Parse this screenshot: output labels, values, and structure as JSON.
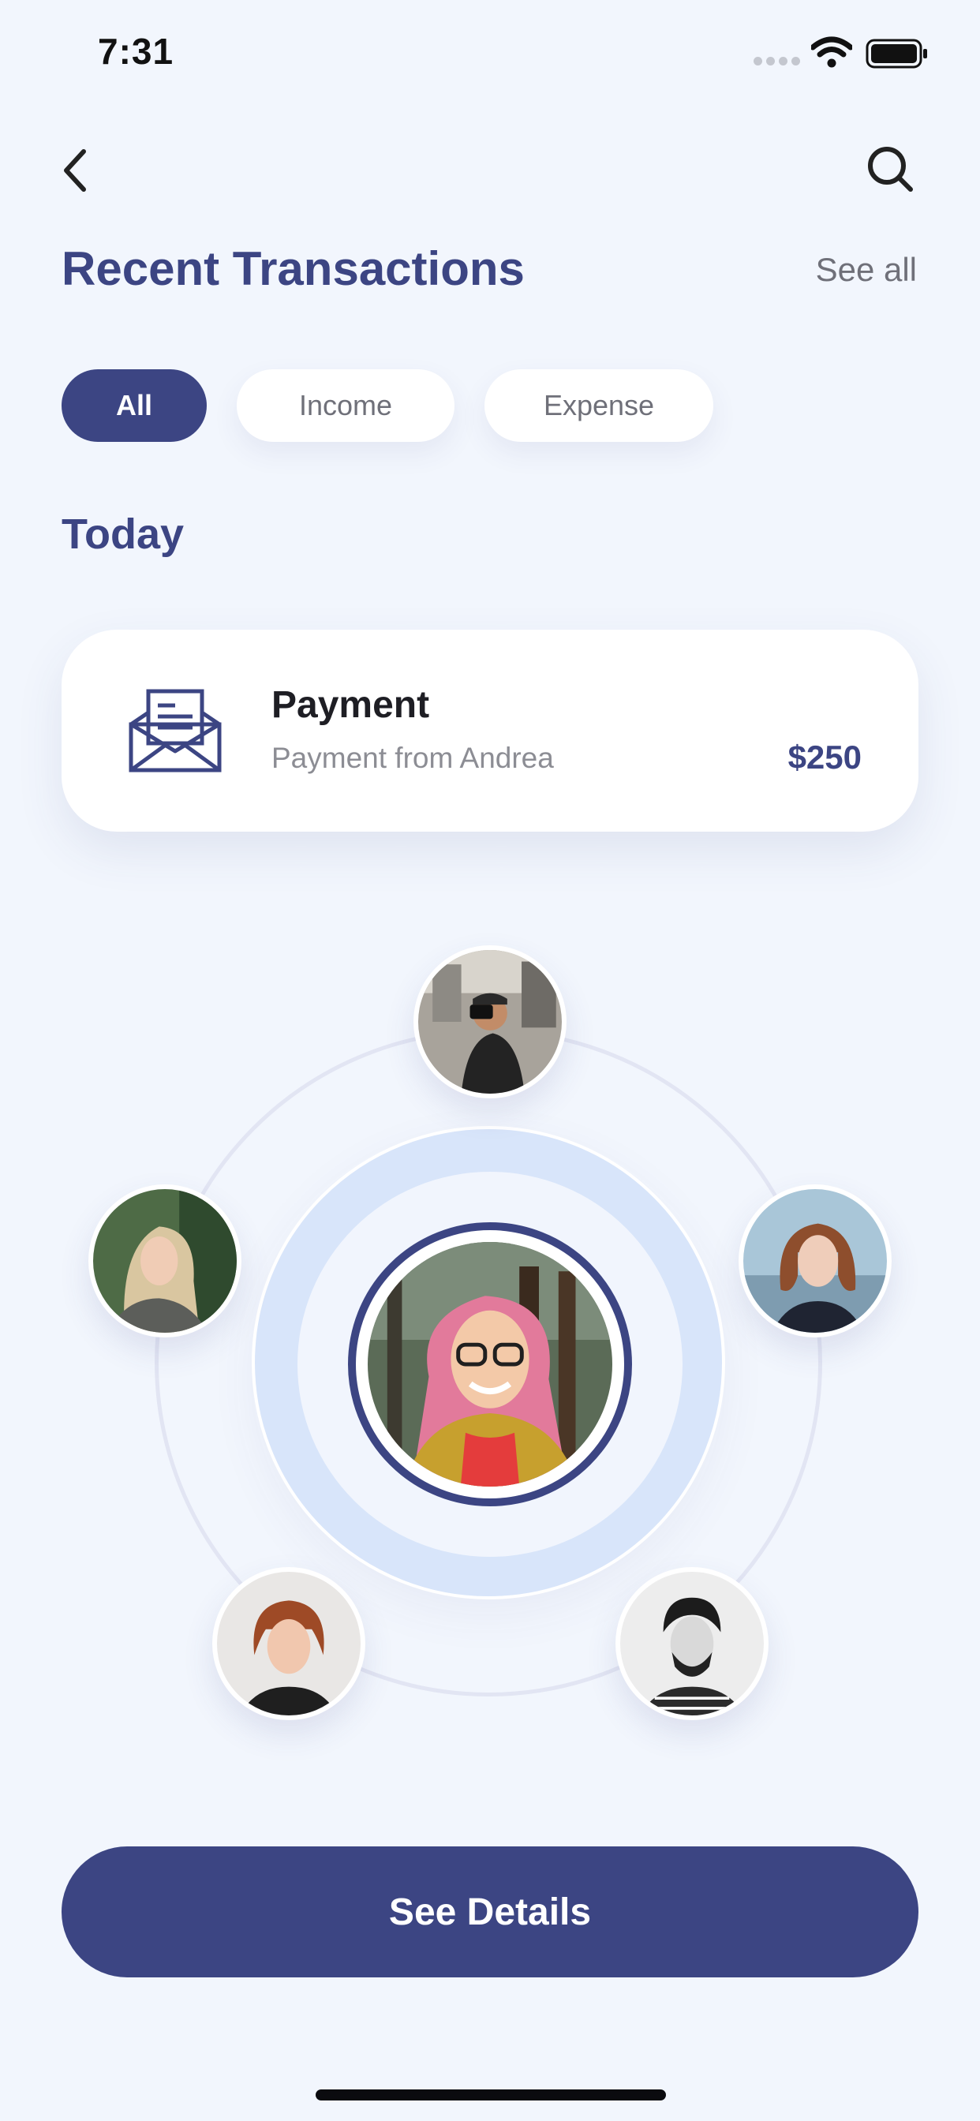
{
  "status_bar": {
    "time": "7:31"
  },
  "header": {
    "title": "Recent Transactions",
    "see_all": "See all"
  },
  "filters": [
    {
      "label": "All",
      "active": true
    },
    {
      "label": "Income",
      "active": false
    },
    {
      "label": "Expense",
      "active": false
    }
  ],
  "section_label": "Today",
  "transaction": {
    "icon": "mail-icon",
    "title": "Payment",
    "subtitle": "Payment from Andrea",
    "amount": "$250"
  },
  "contacts_cluster": {
    "center": "avatar-center",
    "satellites": [
      "avatar-top",
      "avatar-left",
      "avatar-right",
      "avatar-bottom-left",
      "avatar-bottom-right"
    ]
  },
  "cta": {
    "label": "See Details"
  },
  "colors": {
    "accent": "#3C4583",
    "background": "#F2F6FD",
    "hub_ring": "#D8E5FA",
    "muted_text": "#8C8D94"
  }
}
